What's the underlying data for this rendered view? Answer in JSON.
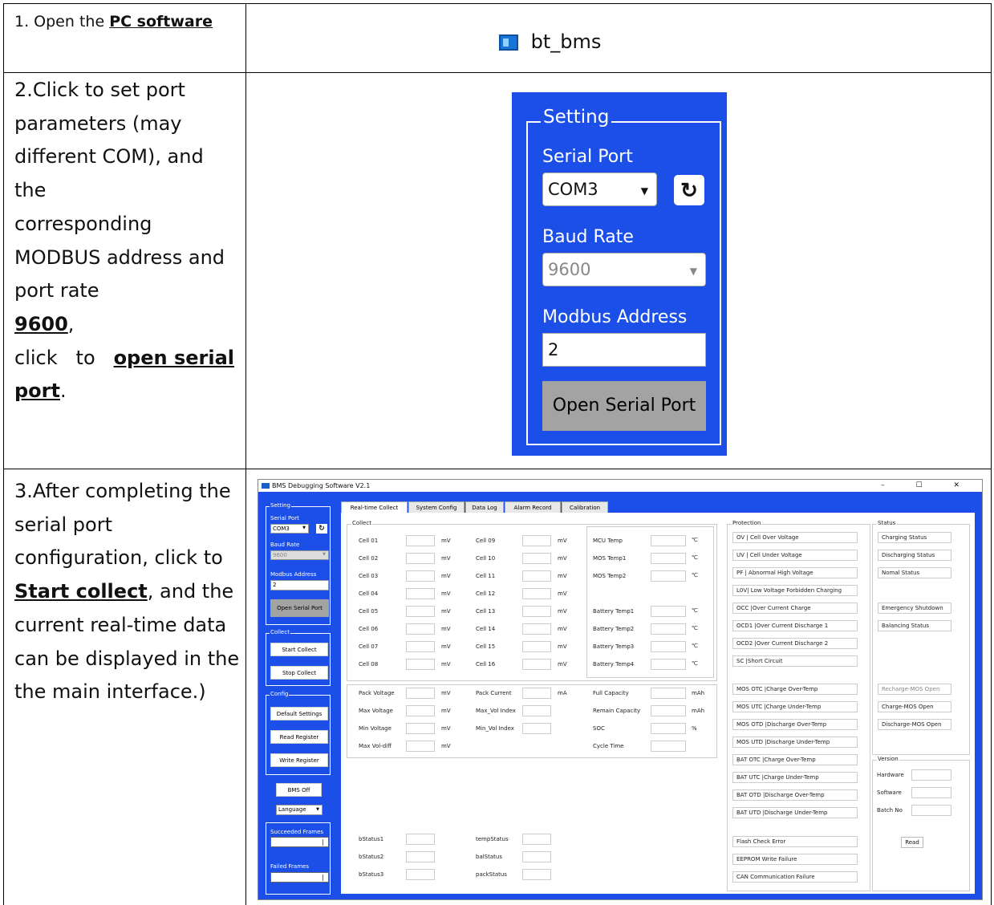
{
  "rows": [
    {
      "step_prefix": "1. Open the ",
      "step_link": "PC software",
      "app_name": "bt_bms"
    },
    {
      "lines": [
        "2.Click to set port",
        "parameters (may",
        "different COM), and the",
        "corresponding",
        "MODBUS address and",
        "port rate"
      ],
      "baud_highlight": "9600",
      "comma": ",",
      "click_word": "click",
      "to_word": "to",
      "action_link1": "open serial",
      "action_link2": "port",
      "period": "."
    },
    {
      "line1": "3.After completing the",
      "line2": "serial port",
      "line3": "configuration, click to",
      "action_link": "Start collect",
      "line4_rest": ", and the",
      "line5": "current real-time data",
      "line6": "can be displayed in the",
      "line7": "the main interface.)"
    }
  ],
  "setting_panel": {
    "legend": "Setting",
    "serial_port_label": "Serial Port",
    "serial_port_value": "COM3",
    "baud_rate_label": "Baud Rate",
    "baud_rate_value": "9600",
    "modbus_label": "Modbus Address",
    "modbus_value": "2",
    "open_button": "Open Serial Port",
    "refresh_icon": "refresh-icon"
  },
  "app": {
    "title": "BMS Debugging Software V2.1",
    "win_controls": "–  ☐  ✕",
    "left": {
      "setting": "Setting",
      "serial_port": "Serial Port",
      "com": "COM3",
      "baud_rate": "Baud Rate",
      "baud": "9600",
      "modbus_address": "Modbus Address",
      "modbus": "2",
      "open_serial_port": "Open Serial Port",
      "collect": "Collect",
      "start_collect": "Start Collect",
      "stop_collect": "Stop Collect",
      "config": "Config",
      "default_settings": "Default Settings",
      "read_register": "Read Register",
      "write_register": "Write Register",
      "bms_off": "BMS Off",
      "language": "Language",
      "succeeded_frames": "Succeeded Frames",
      "failed_frames": "Failed Frames"
    },
    "tabs": [
      "Real-time Collect",
      "System Config",
      "Data Log",
      "Alarm Record",
      "Calibration"
    ],
    "collect_legend": "Collect",
    "cells_left": [
      "Cell 01",
      "Cell 02",
      "Cell 03",
      "Cell 04",
      "Cell 05",
      "Cell 06",
      "Cell 07",
      "Cell 08"
    ],
    "cells_right": [
      "Cell 09",
      "Cell 10",
      "Cell 11",
      "Cell 12",
      "Cell 13",
      "Cell 14",
      "Cell 15",
      "Cell 16"
    ],
    "unit_mv": "mV",
    "unit_c": "℃",
    "temps": [
      "MCU Temp",
      "MOS Temp1",
      "MOS Temp2",
      "",
      "Battery Temp1",
      "Battery Temp2",
      "Battery Temp3",
      "Battery Temp4"
    ],
    "pack": {
      "col1": [
        "Pack Voltage",
        "Max Voltage",
        "Min Voltage",
        "Max Vol-diff"
      ],
      "col2": [
        "Pack Current",
        "Max_Vol Index",
        "Min_Vol Index"
      ],
      "col2_unit": "mA",
      "col3": [
        "Full Capacity",
        "Remain Capacity",
        "SOC",
        "Cycle Time"
      ],
      "col3_units": [
        "mAh",
        "mAh",
        "%",
        ""
      ]
    },
    "bstatus": [
      "bStatus1",
      "bStatus2",
      "bStatus3"
    ],
    "mstatus": [
      "tempStatus",
      "balStatus",
      "packStatus"
    ],
    "protection_legend": "Protection",
    "protection_a": [
      "OV | Cell Over Voltage",
      "UV | Cell Under Voltage",
      "PF  | Abnormal High Voltage",
      "L0V| Low Voltage Forbidden Charging",
      "OCC  |Over Current Charge",
      "OCD1 |Over Current Discharge 1",
      "OCD2 |Over Current Discharge 2",
      "SC     |Short Circuit"
    ],
    "protection_b": [
      "MOS OTC |Charge Over-Temp",
      "MOS UTC |Charge Under-Temp",
      "MOS OTD |Discharge Over-Temp",
      "MOS UTD |Discharge Under-Temp",
      "BAT OTC |Charge Over-Temp",
      "BAT UTC |Charge Under-Temp",
      "BAT OTD |Discharge Over-Temp",
      "BAT UTD |Discharge Under-Temp"
    ],
    "protection_c": [
      "Flash Check Error",
      "EEPROM Write Failure",
      "CAN Communication Failure"
    ],
    "status_legend": "Status",
    "status_a": [
      "Charging Status",
      "Discharging Status",
      "Nomal Status"
    ],
    "status_b": [
      "Emergency Shutdown",
      "Balancing Status"
    ],
    "status_c": [
      "Recharge-MOS Open",
      "Charge-MOS Open",
      "Discharge-MOS Open"
    ],
    "version_legend": "Version",
    "version": [
      "Hardware",
      "Software",
      "Batch No"
    ],
    "read_button": "Read"
  }
}
